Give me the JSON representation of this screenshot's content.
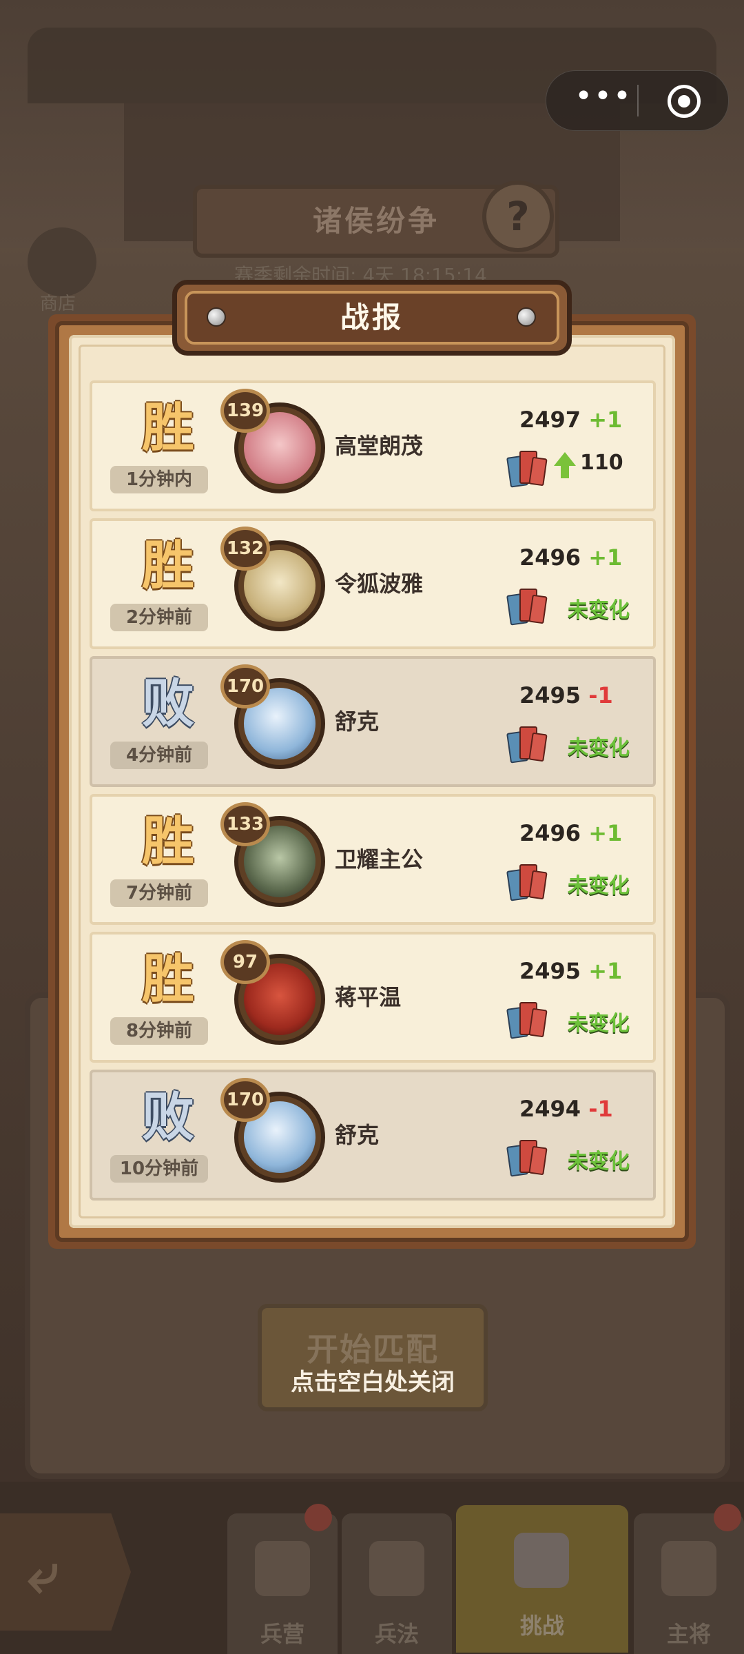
{
  "miniprogram": {
    "more_icon": "more-dots-icon",
    "close_icon": "target-circle-icon",
    "more_label": "•••"
  },
  "background": {
    "event_title": "诸侯纷争",
    "help_label": "?",
    "timer_text": "赛季剩余时间: 4天 18:15:14",
    "shop_label": "商店",
    "match_button": "开始匹配",
    "close_hint": "点击空白处关闭",
    "back_label": "⤶",
    "tabs": [
      {
        "label": "兵营",
        "icon": "barracks-icon"
      },
      {
        "label": "兵法",
        "icon": "scroll-icon"
      },
      {
        "label": "挑战",
        "icon": "crossed-swords-icon"
      },
      {
        "label": "主将",
        "icon": "general-icon"
      }
    ]
  },
  "modal": {
    "title": "战报",
    "records": [
      {
        "result": "胜",
        "time": "1分钟内",
        "level": "139",
        "name": "高堂朗茂",
        "score": "2497",
        "delta": "+1",
        "rank_change": "110",
        "status": ""
      },
      {
        "result": "胜",
        "time": "2分钟前",
        "level": "132",
        "name": "令狐波雅",
        "score": "2496",
        "delta": "+1",
        "rank_change": "",
        "status": "未变化"
      },
      {
        "result": "败",
        "time": "4分钟前",
        "level": "170",
        "name": "舒克",
        "score": "2495",
        "delta": "-1",
        "rank_change": "",
        "status": "未变化"
      },
      {
        "result": "胜",
        "time": "7分钟前",
        "level": "133",
        "name": "卫耀主公",
        "score": "2496",
        "delta": "+1",
        "rank_change": "",
        "status": "未变化"
      },
      {
        "result": "胜",
        "time": "8分钟前",
        "level": "97",
        "name": "蒋平温",
        "score": "2495",
        "delta": "+1",
        "rank_change": "",
        "status": "未变化"
      },
      {
        "result": "败",
        "time": "10分钟前",
        "level": "170",
        "name": "舒克",
        "score": "2494",
        "delta": "-1",
        "rank_change": "",
        "status": "未变化"
      }
    ]
  },
  "colors": {
    "win": "#f6c56b",
    "loss": "#c9d6e6",
    "gain": "#6dbb32",
    "drop": "#e03a3a",
    "panel": "#f3e6cb"
  }
}
